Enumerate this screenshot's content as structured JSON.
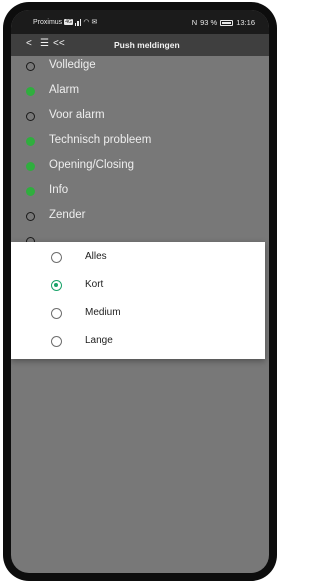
{
  "statusbar": {
    "carrier": "Proximus",
    "carrier_badge": "4G",
    "nfc": "N",
    "battery": "93 %",
    "time": "13:16"
  },
  "appbar": {
    "back_icon": "<",
    "menu_icon": "☰",
    "collapse_icon": "<<",
    "title": "Push meldingen"
  },
  "list": {
    "items": [
      {
        "label": "Volledige",
        "enabled": false
      },
      {
        "label": "Alarm",
        "enabled": true
      },
      {
        "label": "Voor alarm",
        "enabled": false
      },
      {
        "label": "Technisch probleem",
        "enabled": true
      },
      {
        "label": "Opening/Closing",
        "enabled": true
      },
      {
        "label": "Info",
        "enabled": true
      },
      {
        "label": "Zender",
        "enabled": false
      }
    ]
  },
  "dialog": {
    "options": [
      {
        "label": "Alles",
        "selected": false
      },
      {
        "label": "Kort",
        "selected": true
      },
      {
        "label": "Medium",
        "selected": false
      },
      {
        "label": "Lange",
        "selected": false
      }
    ]
  },
  "colors": {
    "enabled_dot": "#2fae3e",
    "selected_radio": "#1aa36a",
    "background": "#787878",
    "header": "#3f3f3f"
  }
}
